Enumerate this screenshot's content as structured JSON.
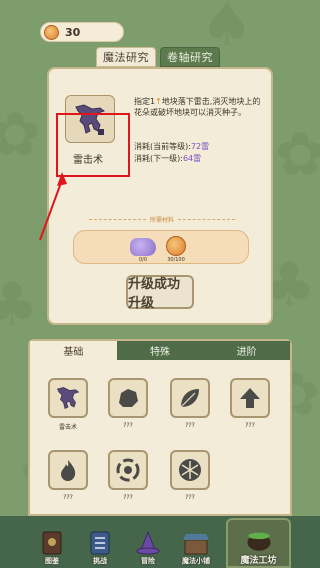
{
  "header": {
    "coin_count": "30"
  },
  "top_tabs": [
    {
      "label": "魔法研究",
      "active": true
    },
    {
      "label": "卷轴研究",
      "active": false
    }
  ],
  "skill_detail": {
    "name": "雷击术",
    "description_parts": [
      "指定1",
      "↑",
      "地块落下雷击,消灭地块上的花朵或破坏地块可以消灭种子。"
    ],
    "cost_current_label": "消耗(当前等级):",
    "cost_current_value": "72雷",
    "cost_next_label": "消耗(下一级):",
    "cost_next_value": "64雷",
    "materials_title": "所需材料",
    "materials": [
      {
        "icon": "purple-crystal-icon",
        "count": "0/0"
      },
      {
        "icon": "coin-icon",
        "count": "30/100"
      }
    ],
    "upgrade_label": "升级成功 升级"
  },
  "sub_tabs": [
    {
      "label": "基础",
      "active": true
    },
    {
      "label": "特殊",
      "active": false
    },
    {
      "label": "进阶",
      "active": false
    }
  ],
  "skills": [
    {
      "name": "雷击术",
      "icon": "lightning-icon"
    },
    {
      "name": "???",
      "icon": "rock-icon"
    },
    {
      "name": "???",
      "icon": "leaf-icon"
    },
    {
      "name": "???",
      "icon": "arrow-up-icon"
    },
    {
      "name": "???",
      "icon": "flame-icon"
    },
    {
      "name": "???",
      "icon": "vortex-icon"
    },
    {
      "name": "???",
      "icon": "snowflake-icon"
    }
  ],
  "bottom_nav": [
    {
      "label": "图鉴",
      "icon": "book-icon"
    },
    {
      "label": "挑战",
      "icon": "challenge-icon"
    },
    {
      "label": "冒险",
      "icon": "wizard-hat-icon"
    },
    {
      "label": "魔法小铺",
      "icon": "shop-icon"
    },
    {
      "label": "魔法工坊",
      "icon": "cauldron-icon",
      "active": true
    }
  ],
  "colors": {
    "background": "#7d9e6c",
    "panel": "#f3ecd9",
    "highlight_red": "#e0161c",
    "accent_purple": "#7a4fc0",
    "nav_bg": "#45664a"
  }
}
